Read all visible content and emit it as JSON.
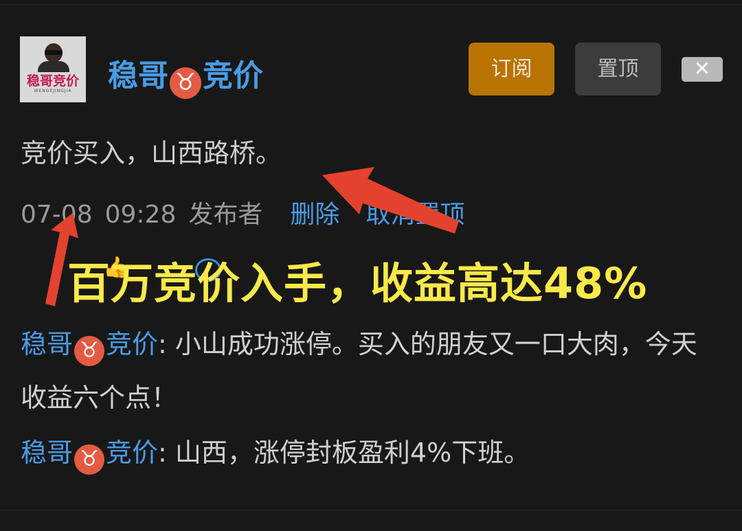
{
  "post": {
    "author": "稳哥♉竞价",
    "author_name_part1": "稳哥",
    "author_name_part2": "竞价",
    "author_emoji": "♉",
    "avatar_brand": "稳哥竞价",
    "avatar_sub": "WENGEJINGJIA",
    "text": "竞价买入，山西路桥。",
    "date": "07-08",
    "time": "09:28",
    "role": "发布者",
    "delete_label": "删除",
    "unpin_label": "取消置顶"
  },
  "header_buttons": {
    "subscribe": "订阅",
    "pin": "置顶",
    "close": "✕"
  },
  "overlay": {
    "banner": "百万竞价入手，收益高达48%"
  },
  "comments": [
    {
      "author_part1": "稳哥",
      "author_emoji": "♉",
      "author_part2": "竞价",
      "text": ": 小山成功涨停。买入的朋友又一口大肉，今天收益六个点！"
    },
    {
      "author_part1": "稳哥",
      "author_emoji": "♉",
      "author_part2": "竞价",
      "text": ": 山西，涨停封板盈利4%下班。"
    }
  ],
  "colors": {
    "background": "#181818",
    "link_blue": "#4a9be6",
    "subscribe_bg": "#b87300",
    "banner_yellow": "#fae94a",
    "arrow_red": "#e3422f"
  }
}
